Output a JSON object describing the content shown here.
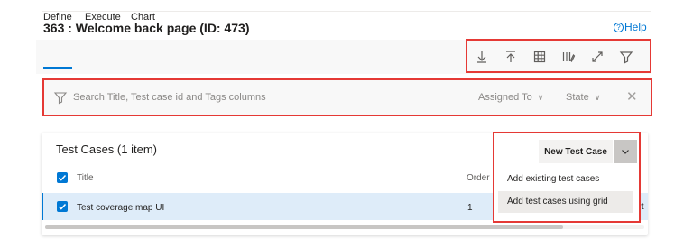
{
  "page": {
    "title": "363 : Welcome back page (ID: 473)",
    "help_label": "Help",
    "help_glyph": "?"
  },
  "tabs": [
    {
      "label": "Define",
      "active": true
    },
    {
      "label": "Execute",
      "active": false
    },
    {
      "label": "Chart",
      "active": false
    }
  ],
  "toolbar": {
    "icons": [
      "download-icon",
      "upload-icon",
      "grid-icon",
      "column-options-icon",
      "fullscreen-icon",
      "filter-icon"
    ]
  },
  "filter": {
    "placeholder": "Search Title, Test case id and Tags columns",
    "assigned_to_label": "Assigned To",
    "state_label": "State",
    "clear_glyph": "✕"
  },
  "test_cases": {
    "heading": "Test Cases (1 item)",
    "new_button_label": "New Test Case",
    "columns": {
      "title": "Title",
      "order": "Order"
    },
    "rows": [
      {
        "title": "Test coverage map UI",
        "order": "1",
        "truncated": "ort",
        "selected": true
      }
    ],
    "menu_items": [
      {
        "label": "Add existing test cases",
        "hover": false
      },
      {
        "label": "Add test cases using grid",
        "hover": true
      }
    ]
  },
  "colors": {
    "accent": "#0078d4",
    "highlight_border": "#e53935",
    "selected_row": "#deecf9"
  }
}
